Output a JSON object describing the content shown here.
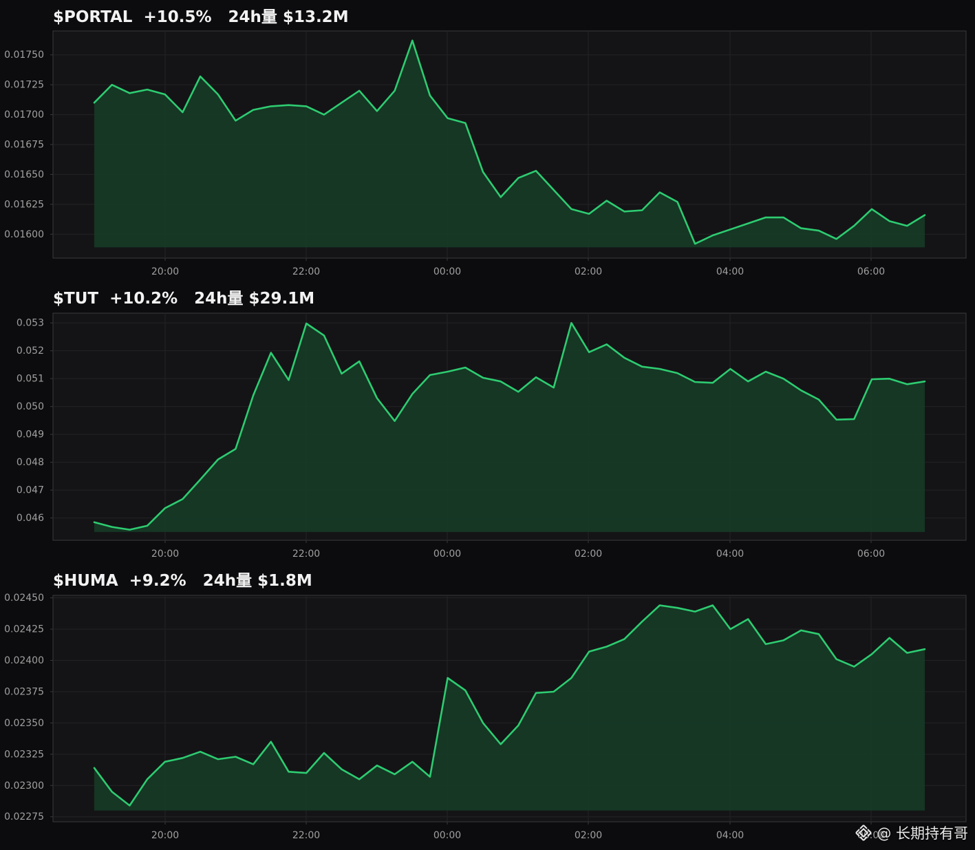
{
  "theme": {
    "background": "#0c0c0e",
    "plot_background": "#141416",
    "grid": "#232327",
    "axis": "#3a3a3e",
    "tick_text": "#a0a0a0",
    "title_text": "#f2f2f2",
    "line": "#2ecc71",
    "fill": "#163b26"
  },
  "x_ticks": [
    "20:00",
    "22:00",
    "00:00",
    "02:00",
    "04:00",
    "06:00"
  ],
  "chart_data": [
    {
      "type": "area",
      "title": "$PORTAL  +10.5%   24h量 $13.2M",
      "series": [
        {
          "values": [
            0.0171,
            0.01725,
            0.01718,
            0.01721,
            0.01717,
            0.01702,
            0.01732,
            0.01717,
            0.01695,
            0.01704,
            0.01707,
            0.01708,
            0.01707,
            0.017,
            0.0171,
            0.0172,
            0.01703,
            0.0172,
            0.01762,
            0.01716,
            0.01697,
            0.01693,
            0.01652,
            0.01631,
            0.01647,
            0.01653,
            0.01637,
            0.01621,
            0.01617,
            0.01628,
            0.01619,
            0.0162,
            0.01635,
            0.01627,
            0.01592,
            0.01599,
            0.01604,
            0.01609,
            0.01614,
            0.01614,
            0.01605,
            0.01603,
            0.01596,
            0.01607,
            0.01621,
            0.01611,
            0.01607,
            0.01616
          ]
        }
      ],
      "y_ticks": [
        "0.01600",
        "0.01625",
        "0.01650",
        "0.01675",
        "0.01700",
        "0.01725",
        "0.01750"
      ],
      "ylim": [
        0.0158,
        0.0177
      ],
      "baseline": 0.01589,
      "xlabel": "",
      "ylabel": "",
      "grid": true
    },
    {
      "type": "area",
      "title": "$TUT  +10.2%   24h量 $29.1M",
      "series": [
        {
          "values": [
            0.04585,
            0.04568,
            0.04558,
            0.04572,
            0.04635,
            0.04668,
            0.04738,
            0.0481,
            0.04848,
            0.0504,
            0.05193,
            0.05095,
            0.05298,
            0.05255,
            0.05118,
            0.05162,
            0.0503,
            0.04948,
            0.05045,
            0.05113,
            0.05125,
            0.0514,
            0.05103,
            0.0509,
            0.05053,
            0.05105,
            0.05068,
            0.053,
            0.05195,
            0.05223,
            0.05175,
            0.05143,
            0.05135,
            0.0512,
            0.05088,
            0.05085,
            0.05135,
            0.0509,
            0.05125,
            0.051,
            0.05058,
            0.05025,
            0.04953,
            0.04955,
            0.05098,
            0.051,
            0.0508,
            0.0509
          ]
        }
      ],
      "y_ticks": [
        "0.046",
        "0.047",
        "0.048",
        "0.049",
        "0.050",
        "0.051",
        "0.052",
        "0.053"
      ],
      "ylim": [
        0.0452,
        0.05335
      ],
      "baseline": 0.0455,
      "xlabel": "",
      "ylabel": "",
      "grid": true
    },
    {
      "type": "area",
      "title": "$HUMA  +9.2%   24h量 $1.8M",
      "series": [
        {
          "values": [
            0.02314,
            0.02295,
            0.02284,
            0.02305,
            0.02319,
            0.02322,
            0.02327,
            0.02321,
            0.02323,
            0.02317,
            0.02335,
            0.02311,
            0.0231,
            0.02326,
            0.02313,
            0.02305,
            0.02316,
            0.02309,
            0.02319,
            0.02307,
            0.02386,
            0.02376,
            0.0235,
            0.02333,
            0.02348,
            0.02374,
            0.02375,
            0.02386,
            0.02407,
            0.02411,
            0.02417,
            0.02431,
            0.02444,
            0.02442,
            0.02439,
            0.02444,
            0.02425,
            0.02433,
            0.02413,
            0.02416,
            0.02424,
            0.02421,
            0.02401,
            0.02395,
            0.02405,
            0.02418,
            0.02406,
            0.02409
          ]
        }
      ],
      "y_ticks": [
        "0.02275",
        "0.02300",
        "0.02325",
        "0.02350",
        "0.02375",
        "0.02400",
        "0.02425",
        "0.02450"
      ],
      "ylim": [
        0.02271,
        0.02452
      ],
      "baseline": 0.0228,
      "xlabel": "",
      "ylabel": "",
      "grid": true
    }
  ],
  "watermark": {
    "text": "@ 长期持有哥",
    "icon": "binance-logo-icon"
  }
}
